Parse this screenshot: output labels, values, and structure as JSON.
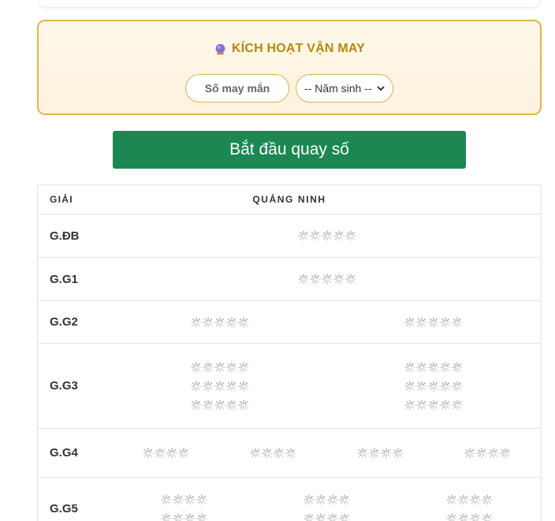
{
  "luck_box": {
    "title": "KÍCH HOẠT VẬN MAY",
    "lucky_number_placeholder": "Số may mắn",
    "birth_year_selected": "-- Năm sinh --"
  },
  "spin_button_label": "Bắt đầu quay số",
  "table": {
    "header_prize": "GIẢI",
    "header_province": "QUẢNG NINH",
    "rows": [
      {
        "label": "G.ĐB",
        "height": 55,
        "cells": [
          [
            5
          ]
        ]
      },
      {
        "label": "G.G1",
        "height": 55,
        "cells": [
          [
            5
          ]
        ]
      },
      {
        "label": "G.G2",
        "height": 54,
        "cells": [
          [
            5
          ],
          [
            5
          ]
        ]
      },
      {
        "label": "G.G3",
        "height": 108,
        "cells": [
          [
            5,
            5,
            5
          ],
          [
            5,
            5,
            5
          ]
        ]
      },
      {
        "label": "G.G4",
        "height": 62,
        "cells": [
          [
            4
          ],
          [
            4
          ],
          [
            4
          ],
          [
            4
          ]
        ]
      },
      {
        "label": "G.G5",
        "height": 80,
        "cells": [
          [
            4,
            4
          ],
          [
            4,
            4
          ],
          [
            4,
            4
          ]
        ]
      }
    ]
  },
  "colors": {
    "accent_gold": "#b8860b",
    "button_green": "#1b8752"
  }
}
